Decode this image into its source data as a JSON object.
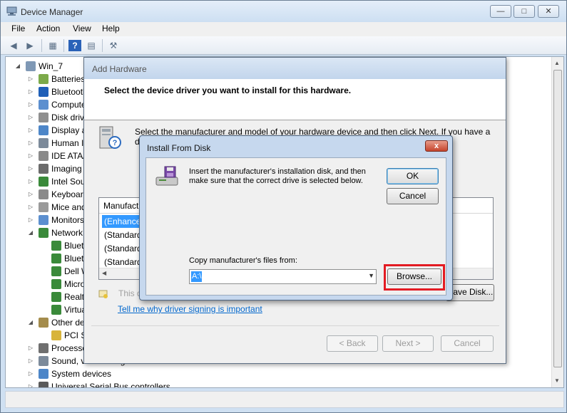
{
  "device_manager": {
    "title": "Device Manager",
    "menu": [
      "File",
      "Action",
      "View",
      "Help"
    ],
    "tree": [
      {
        "label": "Win_7",
        "level": 0,
        "expander": "open",
        "icon": "computer-icon"
      },
      {
        "label": "Batteries",
        "level": 1,
        "expander": "closed",
        "icon": "battery-icon"
      },
      {
        "label": "Bluetooth Radios",
        "level": 1,
        "expander": "closed",
        "icon": "bluetooth-icon"
      },
      {
        "label": "Computer",
        "level": 1,
        "expander": "closed",
        "icon": "monitor-icon"
      },
      {
        "label": "Disk drives",
        "level": 1,
        "expander": "closed",
        "icon": "disk-icon"
      },
      {
        "label": "Display adapters",
        "level": 1,
        "expander": "closed",
        "icon": "display-icon"
      },
      {
        "label": "Human Interface Devices",
        "level": 1,
        "expander": "closed",
        "icon": "hid-icon"
      },
      {
        "label": "IDE ATA/ATAPI controllers",
        "level": 1,
        "expander": "closed",
        "icon": "ide-icon"
      },
      {
        "label": "Imaging devices",
        "level": 1,
        "expander": "closed",
        "icon": "camera-icon"
      },
      {
        "label": "Intel Sound Research Technology",
        "level": 1,
        "expander": "closed",
        "icon": "network-icon"
      },
      {
        "label": "Keyboards",
        "level": 1,
        "expander": "closed",
        "icon": "keyboard-icon"
      },
      {
        "label": "Mice and other pointing devices",
        "level": 1,
        "expander": "closed",
        "icon": "mouse-icon"
      },
      {
        "label": "Monitors",
        "level": 1,
        "expander": "closed",
        "icon": "monitor-icon"
      },
      {
        "label": "Network adapters",
        "level": 1,
        "expander": "open",
        "icon": "network-icon"
      },
      {
        "label": "Bluetooth Device (Personal Area Network)",
        "level": 2,
        "expander": "",
        "icon": "network-icon"
      },
      {
        "label": "Bluetooth Device (RFCOMM Protocol TDI)",
        "level": 2,
        "expander": "",
        "icon": "network-icon"
      },
      {
        "label": "Dell Wireless 1505 Draft 802.11n WLAN Mini-Card",
        "level": 2,
        "expander": "",
        "icon": "network-icon"
      },
      {
        "label": "Microsoft Virtual WiFi Miniport Adapter",
        "level": 2,
        "expander": "",
        "icon": "network-icon"
      },
      {
        "label": "Realtek PCIe FE Family Controller",
        "level": 2,
        "expander": "",
        "icon": "network-icon"
      },
      {
        "label": "VirtualBox Host-Only Ethernet Adapter",
        "level": 2,
        "expander": "",
        "icon": "network-icon"
      },
      {
        "label": "Other devices",
        "level": 1,
        "expander": "open",
        "icon": "other-device-icon"
      },
      {
        "label": "PCI Simple Communications Controller",
        "level": 2,
        "expander": "",
        "icon": "warning-device-icon"
      },
      {
        "label": "Processors",
        "level": 1,
        "expander": "closed",
        "icon": "processor-icon"
      },
      {
        "label": "Sound, video and game controllers",
        "level": 1,
        "expander": "closed",
        "icon": "sound-icon"
      },
      {
        "label": "System devices",
        "level": 1,
        "expander": "closed",
        "icon": "system-icon"
      },
      {
        "label": "Universal Serial Bus controllers",
        "level": 1,
        "expander": "closed",
        "icon": "usb-icon"
      }
    ]
  },
  "add_hardware": {
    "title": "Add Hardware",
    "heading": "Select the device driver you want to install for this hardware.",
    "instructions": "Select the manufacturer and model of your hardware device and then click Next. If you have a disk that contains the driver you want to install, click Have Disk.",
    "list_header": "Manufacturer",
    "list_rows": [
      "(Enhanced",
      "(Standard",
      "(Standard",
      "(Standard"
    ],
    "signed_text": "This driver is digitally signed.",
    "link": "Tell me why driver signing is important",
    "have_disk": "Have Disk...",
    "back": "< Back",
    "next": "Next >",
    "cancel": "Cancel"
  },
  "install_from_disk": {
    "title": "Install From Disk",
    "message": "Insert the manufacturer's installation disk, and then make sure that the correct drive is selected below.",
    "ok": "OK",
    "cancel": "Cancel",
    "copy_label": "Copy manufacturer's files from:",
    "path_value": "A:\\",
    "browse": "Browse...",
    "close_glyph": "x"
  },
  "colors": {
    "highlight": "#e31b23",
    "selection": "#3399ff",
    "link": "#0066cc"
  }
}
